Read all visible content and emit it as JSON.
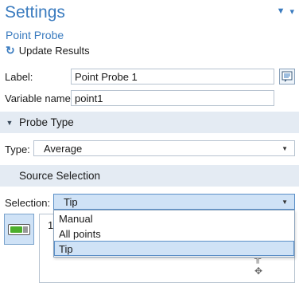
{
  "header": {
    "title": "Settings",
    "subtitle": "Point Probe",
    "update_label": "Update Results"
  },
  "form": {
    "label_caption": "Label:",
    "label_value": "Point Probe 1",
    "variable_caption": "Variable name:",
    "variable_value": "point1"
  },
  "probe_type": {
    "section_title": "Probe Type",
    "type_caption": "Type:",
    "type_value": "Average"
  },
  "source_selection": {
    "section_title": "Source Selection",
    "selection_caption": "Selection:",
    "selection_value": "Tip",
    "list_first_item": "1!",
    "dropdown_options": [
      "Manual",
      "All points",
      "Tip"
    ]
  },
  "colors": {
    "accent": "#3a7bbf",
    "section_bg": "#e4ebf3",
    "selected_bg": "#cfe2f6"
  },
  "icons": [
    "pin-icon",
    "refresh-icon",
    "document-icon",
    "collapse-icon",
    "toggle-icon",
    "add-icon",
    "move-icon"
  ]
}
